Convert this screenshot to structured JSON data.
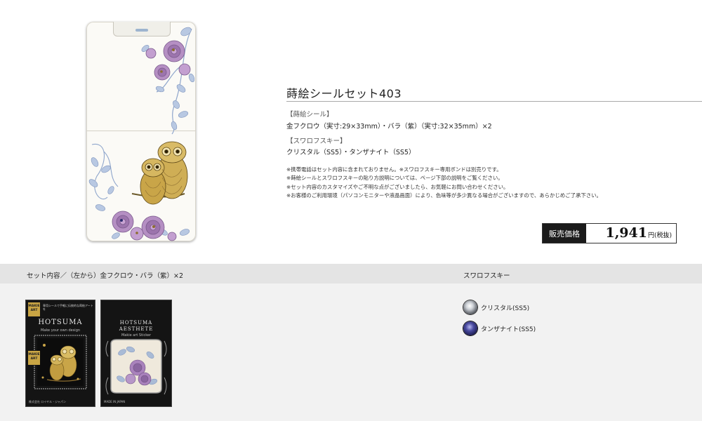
{
  "product": {
    "title": "蒔絵シールセット403",
    "sticker_heading": "【蒔絵シール】",
    "sticker_detail": "金フクロウ（実寸:29×33mm）・バラ（紫）（実寸:32×35mm）×2",
    "crystal_heading": "【スワロフスキー】",
    "crystal_detail": "クリスタル（SS5）・タンザナイト（SS5）",
    "notes": [
      "※携帯電話はセット内容に含まれておりません。※スワロフスキー専用ボンドは別売りです。",
      "※蒔絵シールとスワロフスキーの貼り方説明については、ページ下部の説明をご覧ください。",
      "※セット内容のカスタマイズやご不明な点がございましたら、お気軽にお問い合わせください。",
      "※お客様のご利用環境（パソコンモニターや液晶画面）により、色味等が多少異なる場合がございますので、あらかじめご了承下さい。"
    ]
  },
  "price": {
    "label": "販売価格",
    "value": "1,941",
    "unit": "円(税抜)"
  },
  "set_contents": {
    "label": "セット内容／（左から）金フクロウ・バラ（紫）×2",
    "packages": [
      {
        "badge": "MAKIE ART",
        "top_note": "専用シールで手軽に伝統的な蒔絵アートを",
        "brand": "HOTSUMA",
        "sub": "Make your own design",
        "foot": "株式会社 ロイヤル・ジャパン"
      },
      {
        "brand_line1": "HOTSUMA",
        "brand_line2": "AESTHETE",
        "sub": "Makie art Sticker",
        "foot": "MADE IN JAPAN"
      }
    ]
  },
  "swarovski": {
    "label": "スワロフスキー",
    "items": [
      {
        "name": "クリスタル(SS5)",
        "icon": "crystal-clear-icon"
      },
      {
        "name": "タンザナイト(SS5)",
        "icon": "crystal-tanzanite-icon"
      }
    ]
  },
  "colors": {
    "band": "#e4e4e4",
    "panel": "#f2f2f2",
    "gold": "#c9a544",
    "rose": "#a77fb3",
    "leaf": "#8fa6cc"
  }
}
